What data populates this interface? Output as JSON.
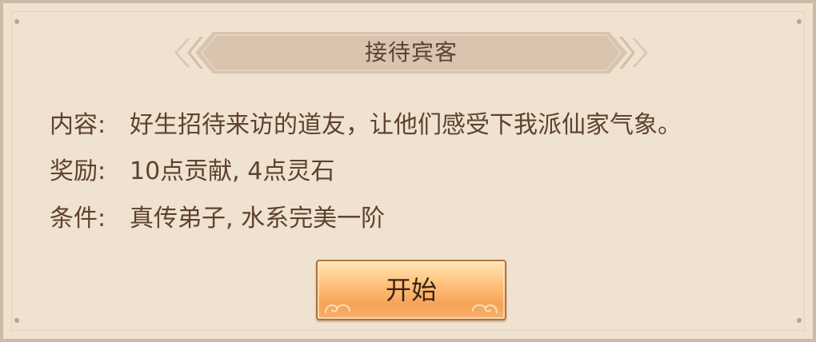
{
  "dialog": {
    "title": "接待宾客",
    "content_label": "内容:",
    "content_value": "好生招待来访的道友，让他们感受下我派仙家气象。",
    "reward_label": "奖励:",
    "reward_value": "10点贡献, 4点灵石",
    "condition_label": "条件:",
    "condition_value": "真传弟子, 水系完美一阶",
    "start_button_label": "开始"
  },
  "colors": {
    "panel_background": "#efe2d1",
    "panel_border": "#cdbba6",
    "title_banner": "#d8c4af",
    "text": "#5e4230",
    "button_gradient_top": "#ffe5b6",
    "button_gradient_bottom": "#f6a358",
    "button_border": "#b5703a"
  },
  "icons": {
    "title_ornament_left": "double-chevron-left-ornament",
    "title_ornament_right": "double-chevron-right-ornament",
    "button_ornament": "cloud-swirl-icon"
  }
}
